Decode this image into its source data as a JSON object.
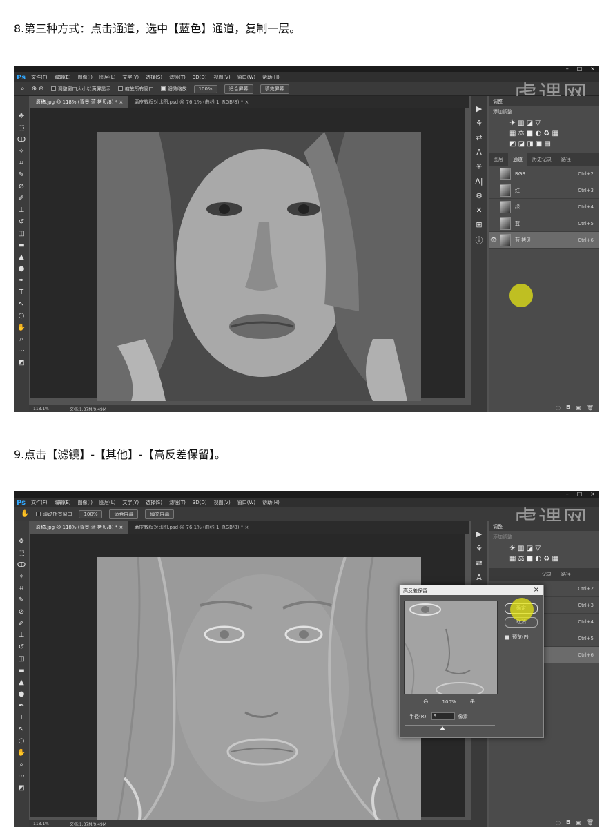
{
  "step8": {
    "caption": "8.第三种方式：点击通道，选中【蓝色】通道，复制一层。"
  },
  "step9": {
    "caption": "9.点击【滤镜】-【其他】-【高反差保留】。"
  },
  "app": {
    "logo": "Ps",
    "menu": [
      "文件(F)",
      "编辑(E)",
      "图像(I)",
      "图层(L)",
      "文字(Y)",
      "选择(S)",
      "滤镜(T)",
      "3D(D)",
      "视图(V)",
      "窗口(W)",
      "帮助(H)"
    ],
    "window_controls": [
      "–",
      "□",
      "×"
    ],
    "watermark": "虎课网",
    "tabs": [
      "原稿.jpg @ 118% (背景 蓝 拷贝/8) *",
      "磨皮教程对比图.psd @ 76.1% (曲线 1, RGB/8) *"
    ],
    "tab_close": "×",
    "status_zoom": "118.1%",
    "status_doc": "文档:1.37M/9.49M"
  },
  "shot1": {
    "options": {
      "resize_windows": "调整窗口大小以满屏显示",
      "zoom_all": "缩放所有窗口",
      "scrubby_zoom": "细微缩放",
      "zoom_value": "100%",
      "fit_screen": "适合屏幕",
      "fill_screen": "填充屏幕"
    },
    "panel": {
      "header": "调整",
      "add_adjustment": "添加调整",
      "channel_tabs": [
        "图层",
        "通道",
        "历史记录",
        "路径"
      ],
      "active_tab": "通道",
      "channels": [
        {
          "name": "RGB",
          "shortcut": "Ctrl+2"
        },
        {
          "name": "红",
          "shortcut": "Ctrl+3"
        },
        {
          "name": "绿",
          "shortcut": "Ctrl+4"
        },
        {
          "name": "蓝",
          "shortcut": "Ctrl+5"
        },
        {
          "name": "蓝 拷贝",
          "shortcut": "Ctrl+6"
        }
      ],
      "eye": "👁"
    }
  },
  "shot2": {
    "options": {
      "scroll_all": "滚动所有窗口",
      "zoom_value": "100%",
      "fit_screen": "适合屏幕",
      "fill_screen": "填充屏幕"
    },
    "panel": {
      "header": "调整",
      "add_adjustment": "添加调整",
      "tab_fragments": [
        "记录",
        "路径"
      ],
      "shortcuts": [
        "Ctrl+2",
        "Ctrl+3",
        "Ctrl+4",
        "Ctrl+5",
        "Ctrl+6"
      ]
    },
    "dialog": {
      "title": "高反差保留",
      "close": "×",
      "ok": "确定",
      "cancel": "取消",
      "preview_label": "预览(P)",
      "zoom_out": "⊖",
      "zoom_level": "100%",
      "zoom_in": "⊕",
      "radius_label": "半径(R):",
      "radius_value": "9",
      "radius_unit": "像素"
    }
  }
}
